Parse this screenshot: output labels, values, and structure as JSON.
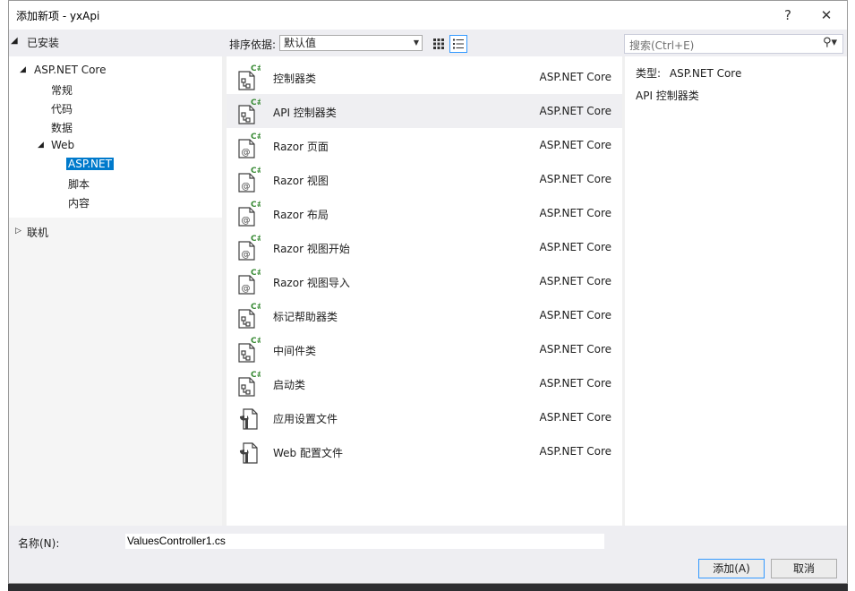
{
  "window": {
    "title": "添加新项 - yxApi",
    "help_symbol": "?",
    "close_symbol": "✕"
  },
  "left": {
    "installed_label": "已安装",
    "tree": [
      {
        "label": "ASP.NET Core"
      },
      {
        "label": "常规"
      },
      {
        "label": "代码"
      },
      {
        "label": "数据"
      },
      {
        "label": "Web"
      },
      {
        "label": "ASP.NET"
      },
      {
        "label": "脚本"
      },
      {
        "label": "内容"
      }
    ],
    "online_label": "联机"
  },
  "toolbar": {
    "sort_label": "排序依据:",
    "sort_value": "默认值",
    "search_placeholder": "搜索(Ctrl+E)"
  },
  "templates": [
    {
      "name": "控制器类",
      "category": "ASP.NET Core",
      "icon": "csharp-class-icon"
    },
    {
      "name": "API 控制器类",
      "category": "ASP.NET Core",
      "icon": "csharp-class-icon"
    },
    {
      "name": "Razor 页面",
      "category": "ASP.NET Core",
      "icon": "razor-file-icon"
    },
    {
      "name": "Razor 视图",
      "category": "ASP.NET Core",
      "icon": "razor-file-icon"
    },
    {
      "name": "Razor 布局",
      "category": "ASP.NET Core",
      "icon": "razor-file-icon"
    },
    {
      "name": "Razor 视图开始",
      "category": "ASP.NET Core",
      "icon": "razor-file-icon"
    },
    {
      "name": "Razor 视图导入",
      "category": "ASP.NET Core",
      "icon": "razor-file-icon"
    },
    {
      "name": "标记帮助器类",
      "category": "ASP.NET Core",
      "icon": "csharp-class-icon"
    },
    {
      "name": "中间件类",
      "category": "ASP.NET Core",
      "icon": "csharp-class-icon"
    },
    {
      "name": "启动类",
      "category": "ASP.NET Core",
      "icon": "csharp-class-icon"
    },
    {
      "name": "应用设置文件",
      "category": "ASP.NET Core",
      "icon": "config-file-icon"
    },
    {
      "name": "Web 配置文件",
      "category": "ASP.NET Core",
      "icon": "config-file-icon"
    }
  ],
  "details": {
    "type_label": "类型:",
    "type_value": "ASP.NET Core",
    "description": "API 控制器类"
  },
  "footer": {
    "name_label": "名称(N):",
    "name_value": "ValuesController1.cs",
    "add_label": "添加(A)",
    "cancel_label": "取消"
  },
  "colors": {
    "accent": "#007acc",
    "selection": "#efeff2",
    "panel": "#eeeef2"
  }
}
